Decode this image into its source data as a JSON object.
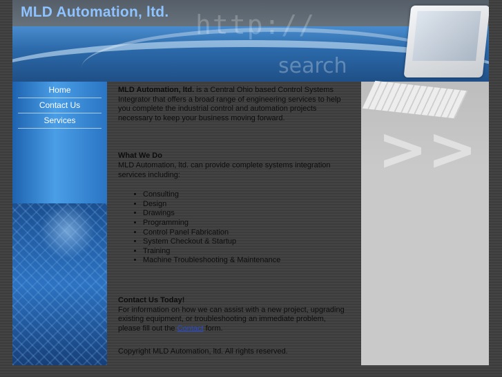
{
  "site_title": "MLD Automation, ltd.",
  "header_ghost": {
    "url_text": "http://",
    "search_text": "search"
  },
  "nav": {
    "items": [
      {
        "label": "Home"
      },
      {
        "label": "Contact Us"
      },
      {
        "label": "Services"
      }
    ]
  },
  "intro": {
    "company": "MLD Automation, ltd.",
    "text": " is a Central Ohio based Control Systems Integrator that offers a broad range of engineering services to help you complete the industrial control and automation projects necessary to keep your business moving forward."
  },
  "what_we_do": {
    "heading": "What We Do",
    "text": "MLD Automation, ltd. can provide complete systems integration services including:",
    "services": [
      "Consulting",
      "Design",
      "Drawings",
      "Programming",
      "Control Panel Fabrication",
      "System Checkout & Startup",
      "Training",
      "Machine Troubleshooting & Maintenance"
    ]
  },
  "contact": {
    "heading": "Contact Us Today!",
    "text_before": "For information on how we can assist with a new project, upgrading existing equipment, or troubleshooting an immediate problem, please fill out the ",
    "link": "Contact",
    "text_after": " form."
  },
  "copyright": "Copyright MLD Automation, ltd. All rights reserved.",
  "right_panel": {
    "chevrons": ">>"
  },
  "colors": {
    "title": "#8ec3ff",
    "link": "#2a4cc8",
    "nav_text": "#ffffff"
  }
}
